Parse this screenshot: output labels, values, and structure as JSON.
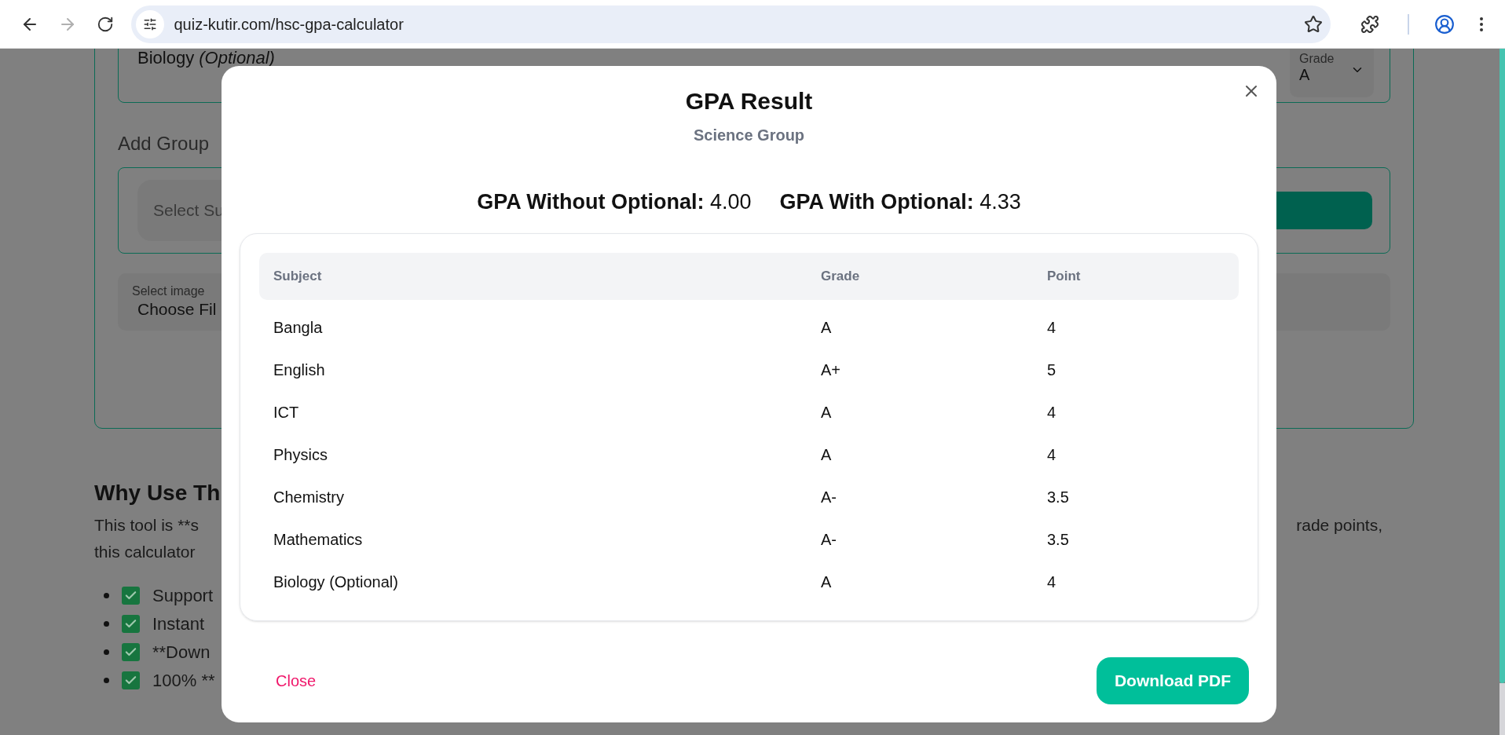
{
  "browser": {
    "url": "quiz-kutir.com/hsc-gpa-calculator",
    "forward_disabled": true
  },
  "page": {
    "subject_card": {
      "name": "Biology *(Optional)*",
      "grade_label": "Grade",
      "grade_value": "A"
    },
    "add_group_label": "Add Group",
    "group_select": {
      "placeholder": "Select Su"
    },
    "image_label": "Select image",
    "file_button": "Choose Fil",
    "why_heading": "Why Use Th",
    "paragraph": {
      "line1_left": "This tool is **s",
      "line1_right": "rade points,",
      "line2_left": "this calculator"
    },
    "features": [
      {
        "text": "Support"
      },
      {
        "text": "Instant"
      },
      {
        "text": "**Down"
      },
      {
        "text": "100% **"
      }
    ]
  },
  "modal": {
    "title": "GPA Result",
    "subtitle": "Science Group",
    "summary": [
      {
        "label": "GPA Without Optional:",
        "value": "4.00"
      },
      {
        "label": "GPA With Optional:",
        "value": "4.33"
      }
    ],
    "table": {
      "columns": [
        "Subject",
        "Grade",
        "Point"
      ],
      "rows": [
        [
          "Bangla",
          "A",
          "4"
        ],
        [
          "English",
          "A+",
          "5"
        ],
        [
          "ICT",
          "A",
          "4"
        ],
        [
          "Physics",
          "A",
          "4"
        ],
        [
          "Chemistry",
          "A-",
          "3.5"
        ],
        [
          "Mathematics",
          "A-",
          "3.5"
        ],
        [
          "Biology (Optional)",
          "A",
          "4"
        ]
      ]
    },
    "close_label": "Close",
    "download_label": "Download PDF"
  }
}
